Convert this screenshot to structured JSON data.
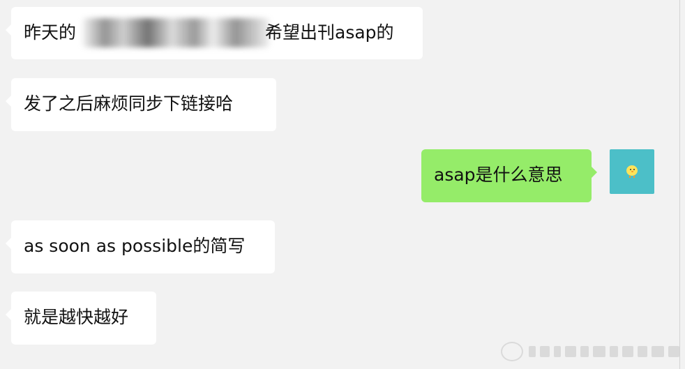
{
  "messages": [
    {
      "side": "left",
      "parts": [
        "昨天的",
        "希望出刊asap的"
      ],
      "has_redaction": true
    },
    {
      "side": "left",
      "text": "发了之后麻烦同步下链接哈"
    },
    {
      "side": "right",
      "text": "asap是什么意思"
    },
    {
      "side": "left",
      "text": "as soon as possible的简写"
    },
    {
      "side": "left",
      "text": "就是越快越好"
    }
  ],
  "colors": {
    "background": "#f2f2f2",
    "incoming_bubble": "#ffffff",
    "outgoing_bubble": "#95ec69",
    "avatar_bg": "#4cbfc8"
  },
  "avatar": {
    "icon": "chick-icon"
  },
  "watermark": {
    "icon": "weibo-watermark-logo"
  }
}
